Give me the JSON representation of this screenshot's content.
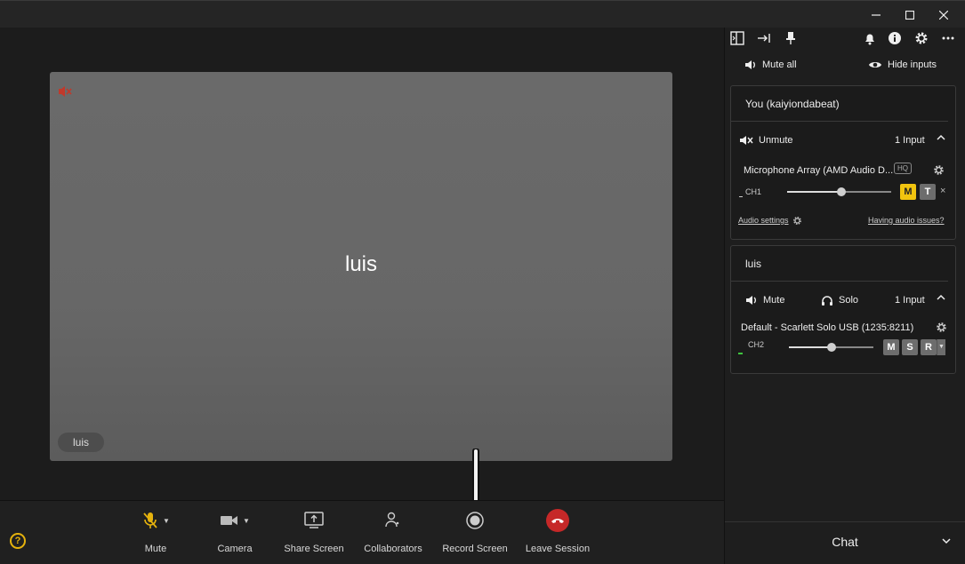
{
  "window": {
    "minimize": "—",
    "maximize": "☐",
    "close": "✕"
  },
  "video": {
    "participant_name": "luis",
    "name_pill": "luis"
  },
  "toolbar": {
    "mute_label": "Mute",
    "camera_label": "Camera",
    "share_label": "Share Screen",
    "collaborators_label": "Collaborators",
    "record_label": "Record Screen",
    "leave_label": "Leave Session",
    "help_glyph": "?"
  },
  "panel": {
    "mute_all": "Mute all",
    "hide_inputs": "Hide inputs",
    "you": {
      "title": "You (kaiyiondabeat)",
      "unmute_label": "Unmute",
      "inputs_count": "1 Input",
      "device": "Microphone Array (AMD Audio D...",
      "hq_badge": "HQ",
      "channel": "CH1",
      "m": "M",
      "t": "T",
      "remove": "×",
      "volume": 0.52,
      "audio_settings": "Audio settings",
      "having_issues": "Having audio issues?"
    },
    "luis": {
      "title": "luis",
      "mute_label": "Mute",
      "solo_label": "Solo",
      "inputs_count": "1 Input",
      "device": "Default - Scarlett Solo USB (1235:8211)",
      "channel": "CH2",
      "m": "M",
      "s": "S",
      "r": "R",
      "volume": 0.5
    },
    "chat_label": "Chat"
  },
  "colors": {
    "accent_yellow": "#f1c40f",
    "muted_red": "#c0392b",
    "leave_red": "#c62828",
    "help_yellow": "#e5b20d"
  }
}
